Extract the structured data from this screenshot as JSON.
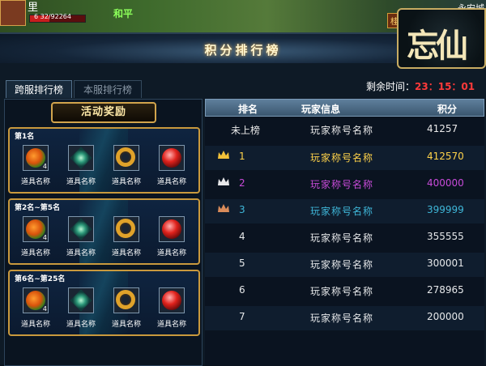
{
  "hud": {
    "player_name": "里",
    "hp_text": "6  32/92264",
    "hp_fraction": 0.35,
    "mode": "和平",
    "location": "永安城",
    "tag": "桂林"
  },
  "logo_text": "忘仙",
  "panel": {
    "title": "积分排行榜",
    "tabs": [
      "跨服排行榜",
      "本服排行榜"
    ],
    "timer_label": "剩余时间：",
    "timer_value": "23：15：01"
  },
  "rewards": {
    "header": "活动奖励",
    "tiers": [
      {
        "label": "第1名",
        "items": [
          {
            "icon": "herb-icon",
            "name": "道具名称",
            "qty": "4"
          },
          {
            "icon": "gem-icon",
            "name": "道具名称",
            "qty": ""
          },
          {
            "icon": "ring-icon",
            "name": "道具名称",
            "qty": ""
          },
          {
            "icon": "orb-icon",
            "name": "道具名称",
            "qty": ""
          }
        ]
      },
      {
        "label": "第2名~第5名",
        "items": [
          {
            "icon": "herb-icon",
            "name": "道具名称",
            "qty": "4"
          },
          {
            "icon": "gem-icon",
            "name": "道具名称",
            "qty": ""
          },
          {
            "icon": "ring-icon",
            "name": "道具名称",
            "qty": ""
          },
          {
            "icon": "orb-icon",
            "name": "道具名称",
            "qty": ""
          }
        ]
      },
      {
        "label": "第6名~第25名",
        "items": [
          {
            "icon": "herb-icon",
            "name": "道具名称",
            "qty": "4"
          },
          {
            "icon": "gem-icon",
            "name": "道具名称",
            "qty": ""
          },
          {
            "icon": "ring-icon",
            "name": "道具名称",
            "qty": ""
          },
          {
            "icon": "orb-icon",
            "name": "道具名称",
            "qty": ""
          }
        ]
      }
    ]
  },
  "leaderboard": {
    "headers": [
      "排名",
      "玩家信息",
      "积分"
    ],
    "self_row": {
      "rank": "未上榜",
      "name": "玩家称号名称",
      "score": "41257"
    },
    "rows": [
      {
        "rank": "1",
        "name": "玩家称号名称",
        "score": "412570",
        "crown": "gold"
      },
      {
        "rank": "2",
        "name": "玩家称号名称",
        "score": "400000",
        "crown": "silver"
      },
      {
        "rank": "3",
        "name": "玩家称号名称",
        "score": "399999",
        "crown": "bronze"
      },
      {
        "rank": "4",
        "name": "玩家称号名称",
        "score": "355555",
        "crown": ""
      },
      {
        "rank": "5",
        "name": "玩家称号名称",
        "score": "300001",
        "crown": ""
      },
      {
        "rank": "6",
        "name": "玩家称号名称",
        "score": "278965",
        "crown": ""
      },
      {
        "rank": "7",
        "name": "玩家称号名称",
        "score": "200000",
        "crown": ""
      }
    ]
  },
  "colors": {
    "gold": "#ffd34a",
    "silver": "#c84bd9",
    "bronze": "#3fb7d9",
    "timer": "#ff3a3a",
    "tier_border": "#c9993d"
  }
}
